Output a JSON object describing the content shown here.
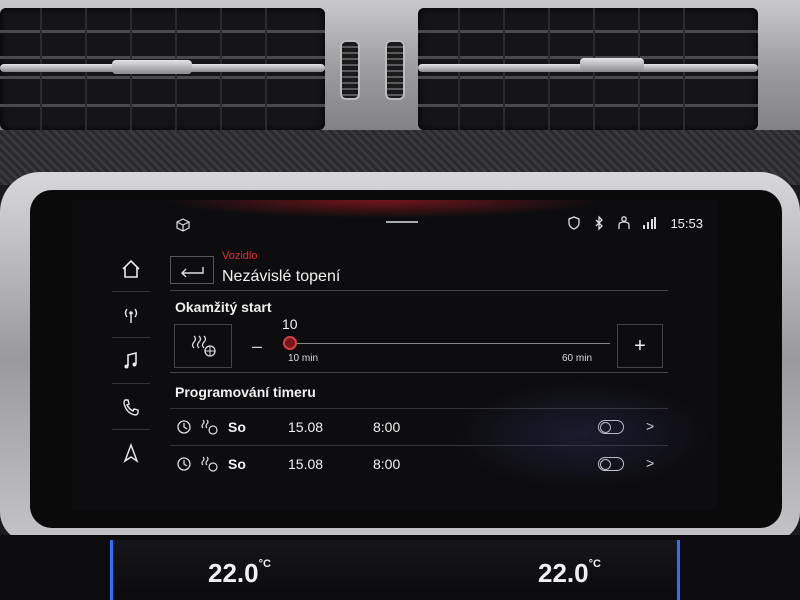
{
  "status_bar": {
    "icons": [
      "cube-icon",
      "navigation-shield-icon",
      "bluetooth-icon",
      "person-icon",
      "wifi-signal-icon"
    ],
    "time": "15:53"
  },
  "sidebar": {
    "items": [
      {
        "icon": "home-icon"
      },
      {
        "icon": "radio-icon"
      },
      {
        "icon": "music-note-icon"
      },
      {
        "icon": "phone-icon"
      },
      {
        "icon": "navigation-arrow-icon"
      }
    ]
  },
  "header": {
    "breadcrumb": "Vozidlo",
    "title": "Nezávislé topení"
  },
  "instant_start": {
    "title": "Okamžitý start",
    "minus_label": "–",
    "plus_label": "+",
    "slider": {
      "value_label": "10",
      "min_label": "10 min",
      "max_label": "60 min",
      "fraction": 0.0
    }
  },
  "timer": {
    "title": "Programování timeru",
    "rows": [
      {
        "day": "So",
        "date": "15.08",
        "time": "8:00",
        "enabled": false,
        "chevron": ">"
      },
      {
        "day": "So",
        "date": "15.08",
        "time": "8:00",
        "enabled": false,
        "chevron": ">"
      }
    ]
  },
  "climate": {
    "left_temp": "22.0",
    "right_temp": "22.0",
    "unit": "°C"
  },
  "colors": {
    "accent_red": "#e03030",
    "screen_bg": "#0d0d0f"
  }
}
